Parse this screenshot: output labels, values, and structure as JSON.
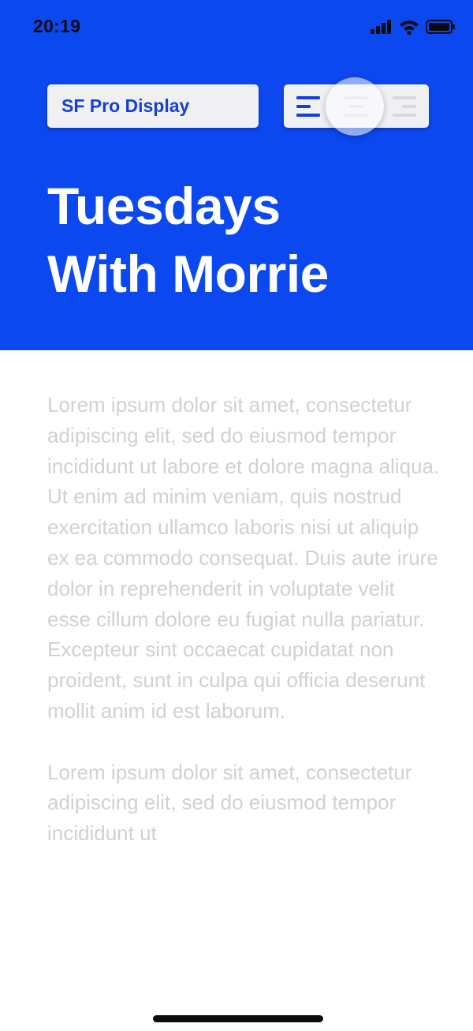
{
  "status_bar": {
    "time": "20:19",
    "icons": [
      "cellular-signal-icon",
      "wifi-icon",
      "battery-icon"
    ]
  },
  "toolbar": {
    "font_label": "SF Pro Display",
    "alignment_options": [
      "align-left-icon",
      "align-center-icon",
      "align-right-icon"
    ],
    "selected_alignment": "left"
  },
  "header": {
    "title_line1": "Tuesdays",
    "title_line2": "With Morrie"
  },
  "body": {
    "paragraphs": [
      "Lorem ipsum dolor sit amet, consectetur adipiscing elit, sed do eiusmod tempor incididunt ut labore et dolore magna aliqua. Ut enim ad minim veniam, quis nostrud exercitation ullamco laboris nisi ut aliquip ex ea commodo consequat. Duis aute irure dolor in reprehenderit in voluptate velit esse cillum dolore eu fugiat nulla pariatur. Excepteur sint occaecat cupidatat non proident, sunt in culpa qui officia deserunt mollit anim id est laborum.",
      "Lorem ipsum dolor sit amet, consectetur adipiscing elit, sed do eiusmod tempor incididunt ut"
    ]
  },
  "colors": {
    "header_background": "#0b48f0",
    "accent": "#1440d8",
    "body_text": "#d0d0d6",
    "control_background": "#f0f0f3"
  }
}
